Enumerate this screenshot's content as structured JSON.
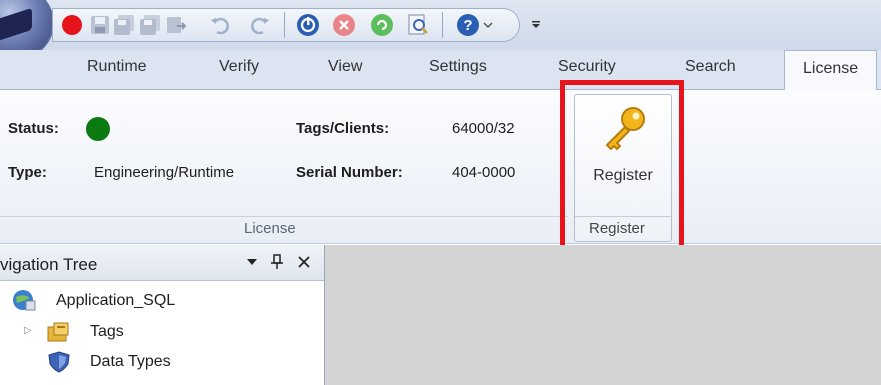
{
  "tabs": [
    {
      "label": "Runtime"
    },
    {
      "label": "Verify"
    },
    {
      "label": "View"
    },
    {
      "label": "Settings"
    },
    {
      "label": "Security"
    },
    {
      "label": "Search"
    },
    {
      "label": "License",
      "active": true
    }
  ],
  "license": {
    "status_label": "Status:",
    "status_color": "#0b7a10",
    "type_label": "Type:",
    "type_value": "Engineering/Runtime",
    "tags_label": "Tags/Clients:",
    "tags_value": "64000/32",
    "serial_label": "Serial Number:",
    "serial_value": "404-0000",
    "group_caption": "License"
  },
  "register": {
    "button_label": "Register",
    "group_caption": "Register",
    "icon": "key-icon",
    "highlight_color": "#e8141c"
  },
  "nav": {
    "title": "vigation Tree",
    "items": [
      {
        "label": "Application_SQL",
        "icon": "globe-app-icon"
      },
      {
        "label": "Tags",
        "icon": "tags-folder-icon"
      },
      {
        "label": "Data Types",
        "icon": "shield-icon"
      }
    ]
  },
  "quick_access": {
    "icons": [
      "record-icon",
      "save-icon",
      "save-all-icon",
      "export-icon",
      "undo-icon",
      "redo-icon",
      "power-icon",
      "stop-icon",
      "refresh-icon",
      "search-document-icon",
      "help-icon"
    ]
  }
}
